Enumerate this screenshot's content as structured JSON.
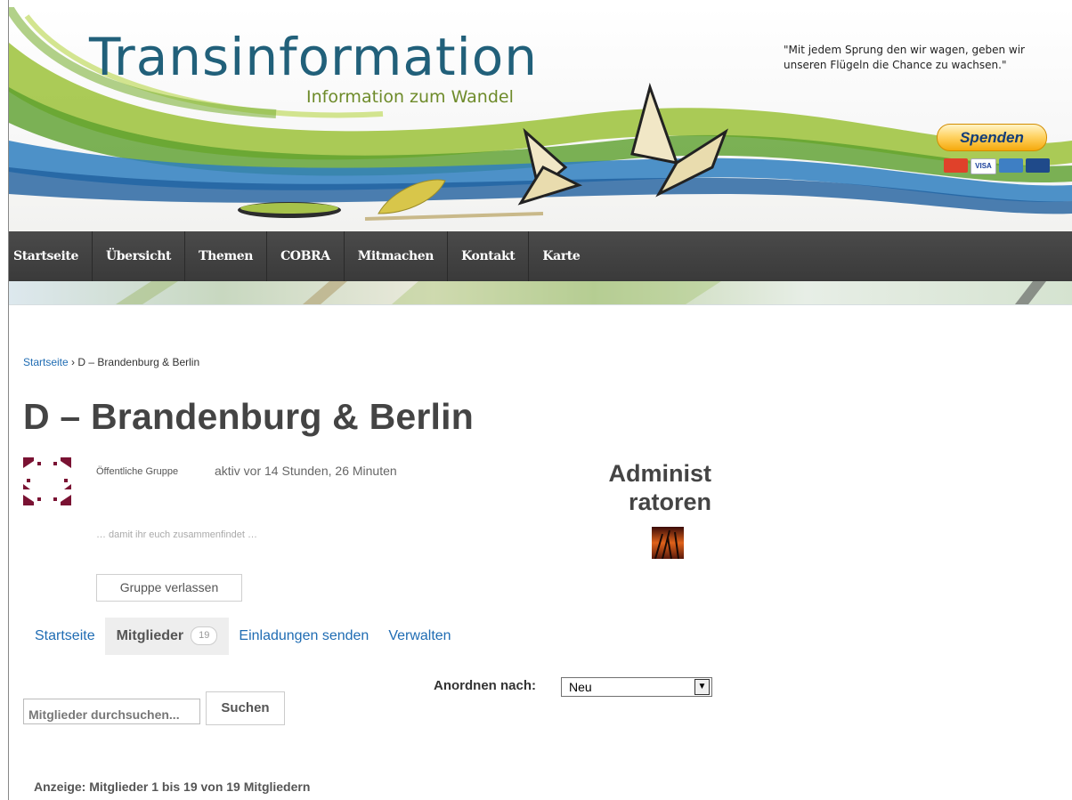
{
  "header": {
    "site_title": "Transinformation",
    "site_subtitle": "Information zum Wandel",
    "quote": "\"Mit jedem Sprung den wir wagen, geben wir unseren Flügeln die Chance zu wachsen.\"",
    "donate_label": "Spenden",
    "cards": [
      "VISA"
    ]
  },
  "nav": {
    "items": [
      "Startseite",
      "Übersicht",
      "Themen",
      "COBRA",
      "Mitmachen",
      "Kontakt",
      "Karte"
    ]
  },
  "breadcrumb": {
    "home": "Startseite",
    "separator": "›",
    "current": "D – Brandenburg & Berlin"
  },
  "group": {
    "title": "D – Brandenburg & Berlin",
    "type": "Öffentliche Gruppe",
    "active": "aktiv vor 14 Stunden, 26 Minuten",
    "description": "… damit ihr euch zusammenfindet …",
    "leave_label": "Gruppe verlassen"
  },
  "admins": {
    "heading_line1": "Administ",
    "heading_line2": "ratoren"
  },
  "tabs": [
    {
      "label": "Startseite"
    },
    {
      "label": "Mitglieder",
      "count": "19"
    },
    {
      "label": "Einladungen senden"
    },
    {
      "label": "Verwalten"
    }
  ],
  "members": {
    "order_label": "Anordnen nach:",
    "order_value": "Neu",
    "search_value": "Mitglieder durchsuchen...",
    "search_label": "Suchen",
    "pagination": "Anzeige: Mitglieder 1 bis 19 von 19 Mitgliedern"
  },
  "colors": {
    "title_blue": "#21607a",
    "subtitle_green": "#6e8b2a",
    "nav_bg": "#3f3f3f",
    "link_blue": "#1f6cb3",
    "donate_gold": "#f5a90c"
  }
}
